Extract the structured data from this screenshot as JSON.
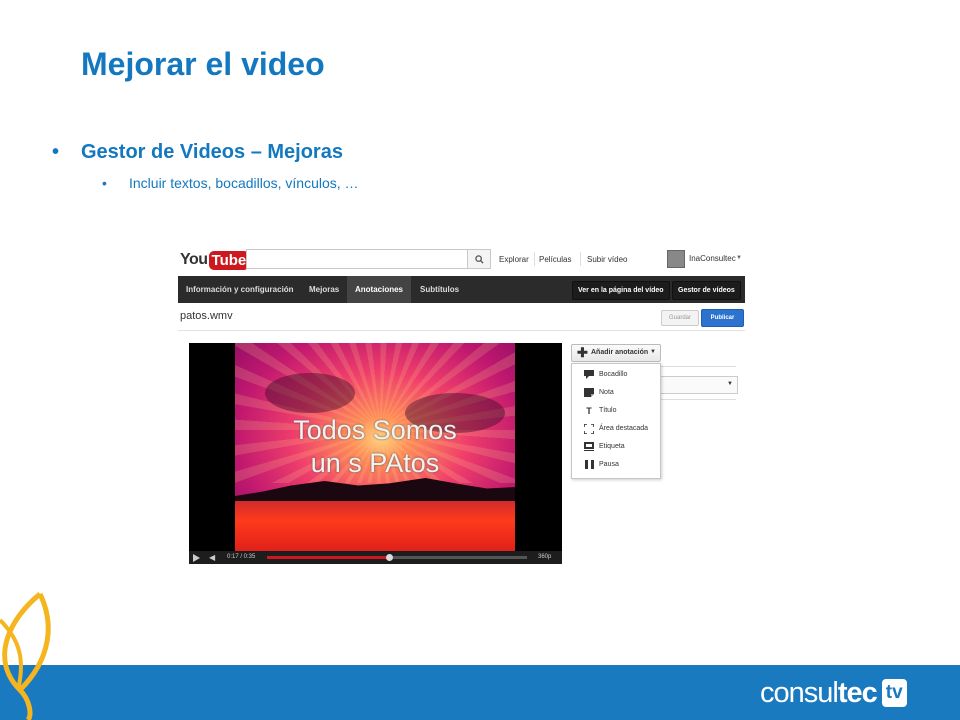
{
  "slide": {
    "title": "Mejorar el video",
    "bullet1": "Gestor de Videos – Mejoras",
    "bullet2": "Incluir textos, bocadillos, vínculos, …",
    "bullet_glyph": "•"
  },
  "youtube": {
    "logo_you": "You",
    "logo_tube": "Tube",
    "search_value": "",
    "nav": [
      "Explorar",
      "Películas",
      "Subir vídeo"
    ],
    "user": "InaConsultec",
    "tabs": [
      "Información y configuración",
      "Mejoras",
      "Anotaciones",
      "Subtítulos"
    ],
    "active_tab": "Anotaciones",
    "right_buttons": [
      "Ver en la página del vídeo",
      "Gestor de vídeos"
    ],
    "filename": "patos.wmv",
    "save_label": "Guardar",
    "publish_label": "Publicar",
    "video": {
      "text_line1": "Todos Somos",
      "text_line2": "un  s PAtos",
      "time": "0:17 / 0:35",
      "progress": 0.47,
      "quality": "360p"
    },
    "add_annotation_label": "Añadir anotación",
    "annotation_types": [
      {
        "label": "Bocadillo",
        "icon": "speech-bubble-icon"
      },
      {
        "label": "Nota",
        "icon": "note-icon"
      },
      {
        "label": "Título",
        "icon": "title-icon"
      },
      {
        "label": "Área destacada",
        "icon": "spotlight-icon"
      },
      {
        "label": "Etiqueta",
        "icon": "label-icon"
      },
      {
        "label": "Pausa",
        "icon": "pause-icon"
      }
    ]
  },
  "brand": {
    "logo_part1": "consul",
    "logo_part2": "tec",
    "logo_part3": "tv",
    "colors": {
      "primary": "#1a7ac0",
      "title": "#1378bf",
      "accent_leaf": "#f5b51e"
    }
  }
}
